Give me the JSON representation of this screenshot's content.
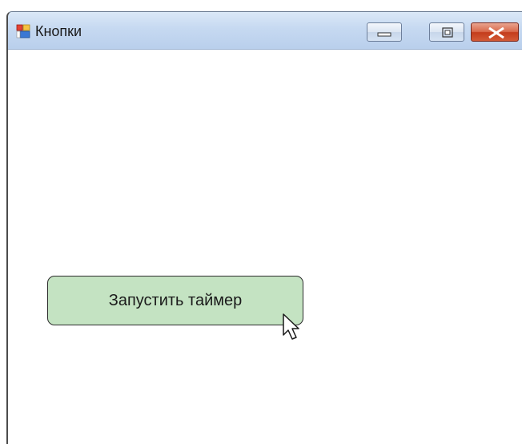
{
  "window": {
    "title": "Кнопки",
    "app_icon": "windows-form-icon"
  },
  "caption_buttons": {
    "minimize_icon": "minimize-icon",
    "maximize_icon": "maximize-icon",
    "close_icon": "close-icon"
  },
  "form": {
    "start_timer_label": "Запустить таймер",
    "button_color": "#c4e3c2"
  },
  "cursor": {
    "icon": "mouse-pointer-icon"
  }
}
